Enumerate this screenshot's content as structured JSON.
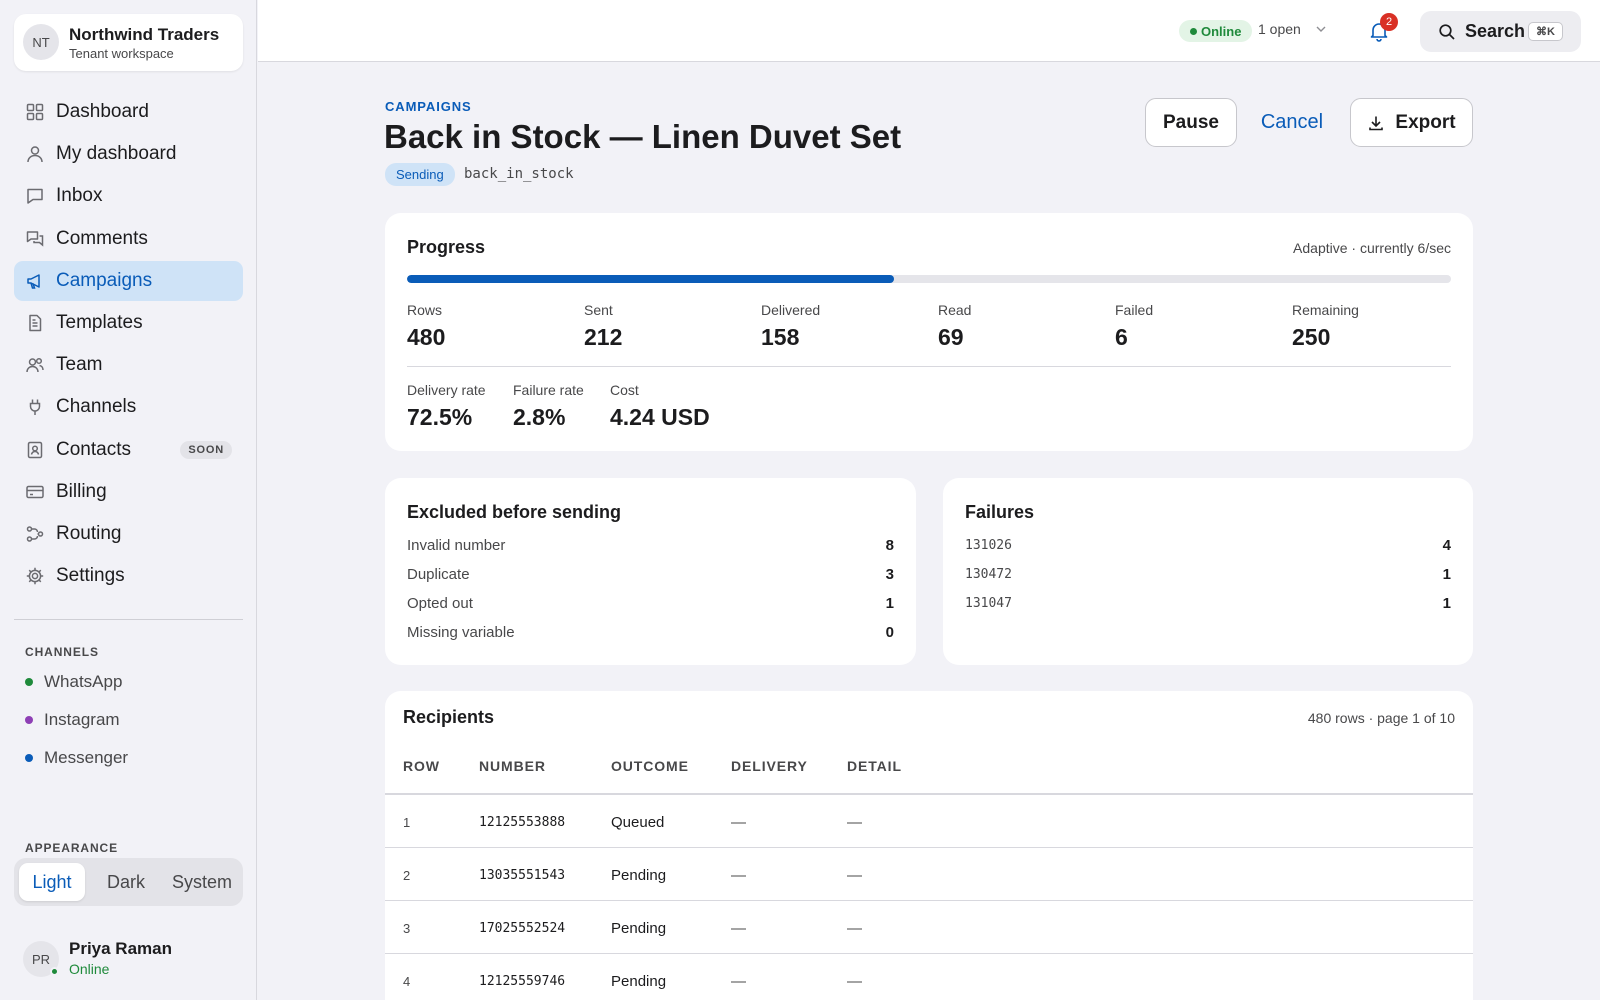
{
  "workspace": {
    "initials": "NT",
    "name": "Northwind Traders",
    "subtitle": "Tenant workspace"
  },
  "nav": [
    {
      "label": "Dashboard",
      "icon": "grid-icon"
    },
    {
      "label": "My dashboard",
      "icon": "person-icon"
    },
    {
      "label": "Inbox",
      "icon": "chat-bubble-icon"
    },
    {
      "label": "Comments",
      "icon": "comments-icon"
    },
    {
      "label": "Campaigns",
      "icon": "megaphone-icon",
      "active": true
    },
    {
      "label": "Templates",
      "icon": "document-icon"
    },
    {
      "label": "Team",
      "icon": "team-icon"
    },
    {
      "label": "Channels",
      "icon": "plug-icon"
    },
    {
      "label": "Contacts",
      "icon": "contact-card-icon",
      "badge": "SOON"
    },
    {
      "label": "Billing",
      "icon": "credit-card-icon"
    },
    {
      "label": "Routing",
      "icon": "routing-icon"
    },
    {
      "label": "Settings",
      "icon": "gear-icon"
    }
  ],
  "channels": {
    "heading": "CHANNELS",
    "items": [
      {
        "label": "WhatsApp",
        "color": "#1f8a3b"
      },
      {
        "label": "Instagram",
        "color": "#8e3fb5"
      },
      {
        "label": "Messenger",
        "color": "#0a5cb8"
      }
    ]
  },
  "appearance": {
    "heading": "APPEARANCE",
    "options": [
      "Light",
      "Dark",
      "System"
    ],
    "selected": "Light"
  },
  "user": {
    "initials": "PR",
    "name": "Priya Raman",
    "status": "Online"
  },
  "topbar": {
    "status": "Online",
    "open_count": "1 open",
    "notifications": "2",
    "search_label": "Search",
    "search_shortcut": "⌘K"
  },
  "header": {
    "eyebrow": "CAMPAIGNS",
    "title": "Back in Stock — Linen Duvet Set",
    "status_badge": "Sending",
    "template_slug": "back_in_stock",
    "pause_label": "Pause",
    "cancel_label": "Cancel",
    "export_label": "Export"
  },
  "progress": {
    "title": "Progress",
    "rate_note": "Adaptive · currently 6/sec",
    "fraction": 0.466,
    "stats": [
      {
        "label": "Rows",
        "value": "480"
      },
      {
        "label": "Sent",
        "value": "212"
      },
      {
        "label": "Delivered",
        "value": "158"
      },
      {
        "label": "Read",
        "value": "69"
      },
      {
        "label": "Failed",
        "value": "6"
      },
      {
        "label": "Remaining",
        "value": "250"
      }
    ],
    "rates": [
      {
        "label": "Delivery rate",
        "value": "72.5%"
      },
      {
        "label": "Failure rate",
        "value": "2.8%"
      },
      {
        "label": "Cost",
        "value": "4.24 USD"
      }
    ]
  },
  "excluded": {
    "title": "Excluded before sending",
    "rows": [
      {
        "label": "Invalid number",
        "value": "8"
      },
      {
        "label": "Duplicate",
        "value": "3"
      },
      {
        "label": "Opted out",
        "value": "1"
      },
      {
        "label": "Missing variable",
        "value": "0"
      }
    ]
  },
  "failures": {
    "title": "Failures",
    "rows": [
      {
        "label": "131026",
        "value": "4"
      },
      {
        "label": "130472",
        "value": "1"
      },
      {
        "label": "131047",
        "value": "1"
      }
    ]
  },
  "recipients": {
    "title": "Recipients",
    "meta": "480 rows · page 1 of 10",
    "columns": [
      "ROW",
      "NUMBER",
      "OUTCOME",
      "DELIVERY",
      "DETAIL"
    ],
    "rows": [
      {
        "row": "1",
        "number": "12125553888",
        "outcome": "Queued",
        "delivery": "—",
        "detail": "—"
      },
      {
        "row": "2",
        "number": "13035551543",
        "outcome": "Pending",
        "delivery": "—",
        "detail": "—"
      },
      {
        "row": "3",
        "number": "17025552524",
        "outcome": "Pending",
        "delivery": "—",
        "detail": "—"
      },
      {
        "row": "4",
        "number": "12125559746",
        "outcome": "Pending",
        "delivery": "—",
        "detail": "—"
      }
    ]
  }
}
